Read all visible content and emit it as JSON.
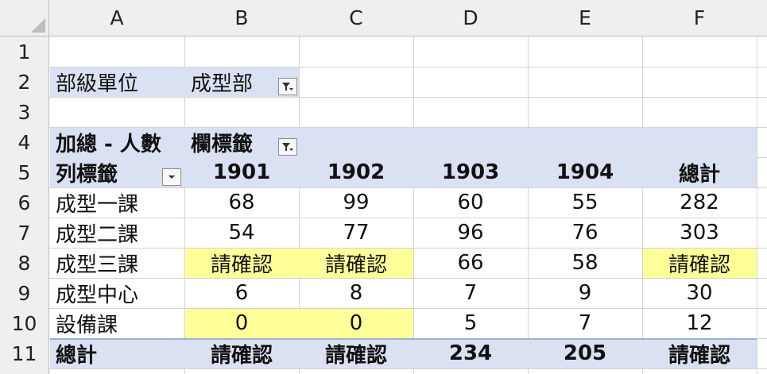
{
  "columns": [
    "A",
    "B",
    "C",
    "D",
    "E",
    "F"
  ],
  "rows": [
    "1",
    "2",
    "3",
    "4",
    "5",
    "6",
    "7",
    "8",
    "9",
    "10",
    "11"
  ],
  "filter": {
    "label": "部級單位",
    "value": "成型部"
  },
  "pivot": {
    "value_label": "加總 - 人數",
    "col_labels_caption": "欄標籤",
    "row_labels_caption": "列標籤",
    "col_headers": [
      "1901",
      "1902",
      "1903",
      "1904",
      "總計"
    ],
    "body": [
      {
        "label": "成型一課",
        "values": [
          "68",
          "99",
          "60",
          "55",
          "282"
        ]
      },
      {
        "label": "成型二課",
        "values": [
          "54",
          "77",
          "96",
          "76",
          "303"
        ]
      },
      {
        "label": "成型三課",
        "values": [
          "請確認",
          "請確認",
          "66",
          "58",
          "請確認"
        ]
      },
      {
        "label": "成型中心",
        "values": [
          "6",
          "8",
          "7",
          "9",
          "30"
        ]
      },
      {
        "label": "設備課",
        "values": [
          "0",
          "0",
          "5",
          "7",
          "12"
        ]
      }
    ],
    "total": {
      "label": "總計",
      "values": [
        "請確認",
        "請確認",
        "234",
        "205",
        "請確認"
      ]
    }
  },
  "colors": {
    "header_band": "#d9e1f2",
    "highlight": "#ffff99"
  }
}
